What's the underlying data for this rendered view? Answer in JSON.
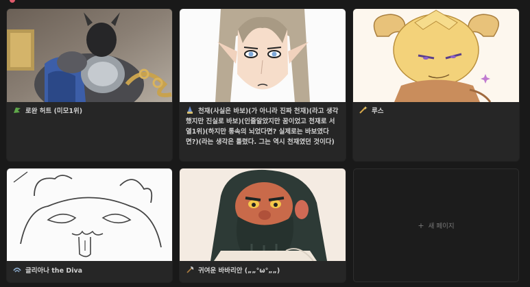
{
  "cards": [
    {
      "title": "로완 허트 (미모1위)",
      "icon": "flag-icon",
      "icon_color": "#5fa84a"
    },
    {
      "title": "천재(사실은 바보)(가 아니라 진짜 천재)(라고 생각했지만 진실로 바보)(인줄알았지만 꿈이었고 천재로 서열1위)(하지만 통속의 뇌었다면? 실제로는 바보였다면?)(라는 생각은 틀렸다. 그는 역시 천재였던 것이다)",
      "icon": "wizard-icon",
      "icon_color": "#6a8fd0"
    },
    {
      "title": "루스",
      "icon": "magic-wand-icon",
      "icon_color": "#e8c55a"
    },
    {
      "title": "글리아나 the Diva",
      "icon": "swirl-icon",
      "icon_color": "#8aa8c8"
    },
    {
      "title": "귀여운 바바리안 („„°ω°„„)",
      "icon": "axe-icon",
      "icon_color": "#d09050"
    }
  ],
  "new_page": {
    "label": "새 페이지",
    "icon": "plus-icon"
  }
}
